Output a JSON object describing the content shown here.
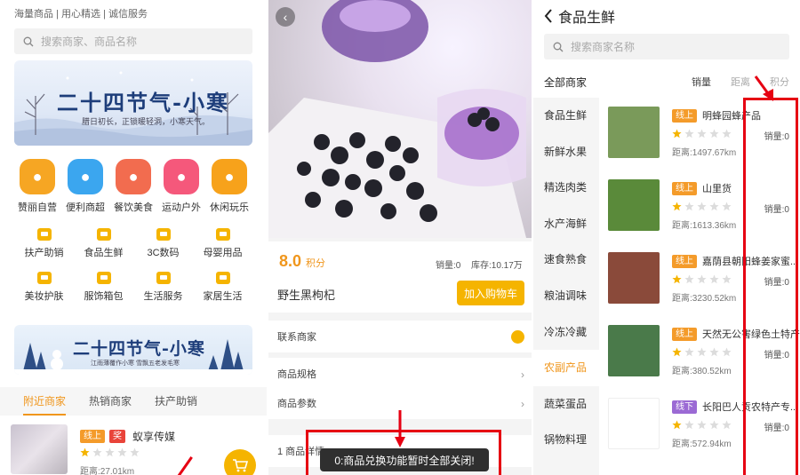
{
  "panel1": {
    "slogan": "海量商品 | 用心精选 | 诚信服务",
    "search_placeholder": "搜索商家、商品名称",
    "banner1": {
      "title": "二十四节气-小寒",
      "subtitle": "腊日初长，正锁暖轻洞，小寒天气。"
    },
    "categories": [
      {
        "label": "赞丽自营",
        "color": "#f6a623"
      },
      {
        "label": "便利商超",
        "color": "#3ba6ef"
      },
      {
        "label": "餐饮美食",
        "color": "#f26c4f"
      },
      {
        "label": "运动户外",
        "color": "#f5587b"
      },
      {
        "label": "休闲玩乐",
        "color": "#f7a21b"
      }
    ],
    "subcategories": [
      "扶产助销",
      "食品生鲜",
      "3C数码",
      "母婴用品",
      "美妆护肤",
      "服饰箱包",
      "生活服务",
      "家居生活"
    ],
    "banner2": {
      "title": "二十四节气-小寒",
      "subtitle": "江雨薄覆作小寒 雪飘五老发毛寒"
    },
    "tabs": [
      "附近商家",
      "热销商家",
      "扶产助销"
    ],
    "merchant": {
      "tag_online": "线上",
      "tag_prize": "奖",
      "name": "蚁享传媒",
      "rating": 1,
      "distance": "距离:27.01km"
    }
  },
  "panel2": {
    "price_value": "8.0",
    "price_unit": "积分",
    "sales": "销量:0",
    "stock": "库存:10.17万",
    "product_name": "野生黑枸杞",
    "add_to_cart": "加入购物车",
    "rows": [
      "联系商家",
      "商品规格",
      "商品参数"
    ],
    "detail_tab": "1 商品详情",
    "toast": "0:商品兑换功能暂时全部关闭!"
  },
  "panel3": {
    "title": "食品生鲜",
    "search_placeholder": "搜索商家名称",
    "all_merchants": "全部商家",
    "sorts": [
      "销量",
      "距离",
      "积分"
    ],
    "sidebar": [
      "食品生鲜",
      "新鲜水果",
      "精选肉类",
      "水产海鲜",
      "速食熟食",
      "粮油调味",
      "冷冻冷藏",
      "农副产品",
      "蔬菜蛋品",
      "锅物料理"
    ],
    "active_sidebar_index": 7,
    "merchants": [
      {
        "tag": "线上",
        "type": "on",
        "name": "明蜂园蜂产品",
        "rating": 1,
        "sales": "销量:0",
        "distance": "距离:1497.67km",
        "thumb": "#7a9a5a"
      },
      {
        "tag": "线上",
        "type": "on",
        "name": "山里货",
        "rating": 1,
        "sales": "销量:0",
        "distance": "距离:1613.36km",
        "thumb": "#5a8a3a"
      },
      {
        "tag": "线上",
        "type": "on",
        "name": "嘉荫县朝阳蜂姜家蜜...",
        "rating": 1,
        "sales": "销量:0",
        "distance": "距离:3230.52km",
        "thumb": "#8a4a3a"
      },
      {
        "tag": "线上",
        "type": "on",
        "name": "天然无公害绿色土特产",
        "rating": 1,
        "sales": "销量:0",
        "distance": "距离:380.52km",
        "thumb": "#4a7a4a"
      },
      {
        "tag": "线下",
        "type": "off",
        "name": "长阳巴人贡农特产专...",
        "rating": 1,
        "sales": "销量:0",
        "distance": "距离:572.94km",
        "thumb": "#ffffff"
      }
    ]
  }
}
